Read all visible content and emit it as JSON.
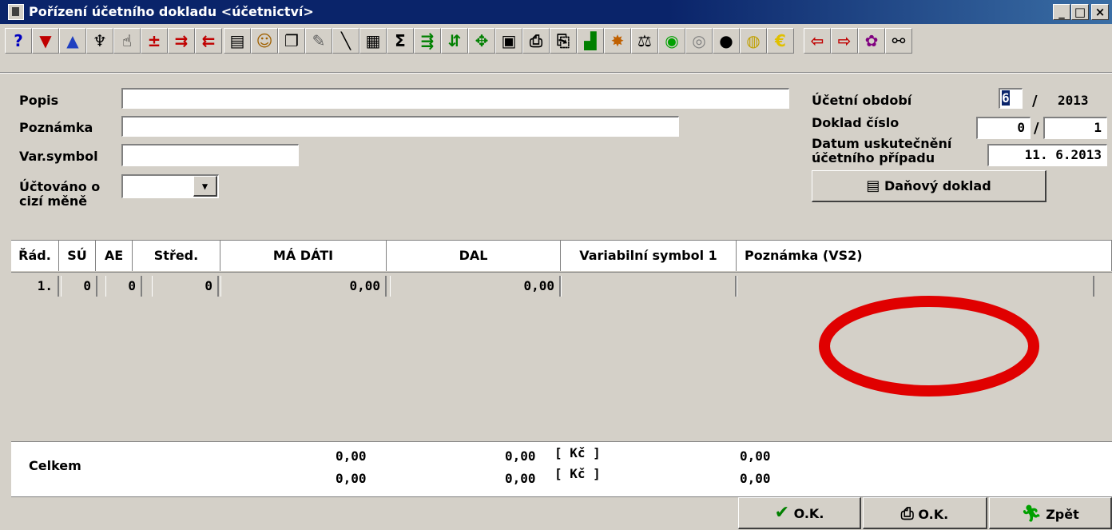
{
  "window": {
    "title": "Pořízení účetního dokladu <účetnictví>",
    "min": "_",
    "max": "□",
    "close": "×"
  },
  "toolbar": [
    "help-icon",
    "filter-down-icon",
    "filter-up-icon",
    "brush-icon",
    "hand-icon",
    "insert-row-icon",
    "insert-row-2-icon",
    "delete-row-icon",
    "notepad-icon",
    "search-person-icon",
    "copy-doc-icon",
    "pencil-icon",
    "line-icon",
    "calculator-window-icon",
    "sum-icon",
    "split-icon",
    "merge-icon",
    "group-icon",
    "calculator-icon",
    "print-preview-icon",
    "print-icon",
    "chart-icon",
    "stamp-icon",
    "scales-icon",
    "green-circle-icon",
    "grey-circle-icon",
    "black-circle-icon",
    "gold-coin-icon",
    "euro-icon",
    "import-icon",
    "export-icon",
    "colors-icon",
    "binoculars-icon"
  ],
  "form": {
    "popis_label": "Popis",
    "popis_value": "",
    "poznamka_label": "Poznámka",
    "poznamka_value": "",
    "var_symbol_label": "Var.symbol",
    "var_symbol_value": "",
    "cizi_mena_label_1": "Účtováno o",
    "cizi_mena_label_2": "cizí měně",
    "cizi_mena_value": "",
    "obdobi_label": "Účetní období",
    "obdobi_month": "6",
    "obdobi_slash": "/",
    "obdobi_year": "2013",
    "doklad_label": "Doklad číslo",
    "doklad_series": "0",
    "doklad_slash": "/",
    "doklad_number": "1",
    "datum_label_1": "Datum uskutečnění",
    "datum_label_2": "účetního případu",
    "datum_value": "11. 6.2013",
    "danovy_doklad": "Daňový doklad"
  },
  "grid": {
    "headers": [
      "Řád.",
      "SÚ",
      "AE",
      "Střed.",
      "MÁ DÁTI",
      "DAL",
      "Variabilní symbol 1",
      "Poznámka (VS2)"
    ],
    "row": {
      "rad": "1.",
      "su": "0",
      "ae": "0",
      "stred": "0",
      "ma_dati": "0,00",
      "dal": "0,00",
      "vs1": "",
      "vs2": ""
    }
  },
  "totals": {
    "label": "Celkem",
    "ma_dati_1": "0,00",
    "dal_1": "0,00",
    "currency_1": "[ Kč ]",
    "diff_1": "0,00",
    "ma_dati_2": "0,00",
    "dal_2": "0,00",
    "currency_2": "[ Kč ]",
    "diff_2": "0,00"
  },
  "buttons": {
    "ok": "O.K.",
    "print_ok": "O.K.",
    "back": "Zpět"
  },
  "colors": {
    "highlight_circle": "#e00000",
    "title_bar": "#0a246a"
  }
}
